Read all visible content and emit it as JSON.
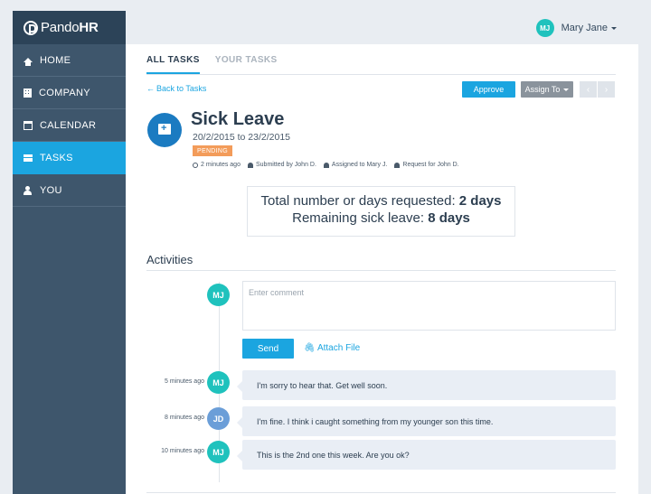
{
  "app": {
    "logo": {
      "prefix": "Pando",
      "suffix": "HR"
    },
    "user": {
      "initials": "MJ",
      "name": "Mary Jane"
    }
  },
  "sidebar": {
    "items": [
      {
        "label": "HOME",
        "icon": "home-icon",
        "active": false
      },
      {
        "label": "COMPANY",
        "icon": "building-icon",
        "active": false
      },
      {
        "label": "CALENDAR",
        "icon": "calendar-icon",
        "active": false
      },
      {
        "label": "TASKS",
        "icon": "tasks-icon",
        "active": true
      },
      {
        "label": "YOU",
        "icon": "user-icon",
        "active": false
      }
    ]
  },
  "tabs": [
    {
      "label": "ALL TASKS",
      "active": true
    },
    {
      "label": "YOUR TASKS",
      "active": false
    }
  ],
  "toolbar": {
    "back_label": "Back to Tasks",
    "approve_label": "Approve",
    "assign_label": "Assign To"
  },
  "task": {
    "title": "Sick Leave",
    "dates": "20/2/2015 to 23/2/2015",
    "status": "PENDING",
    "meta": {
      "time": "2 minutes ago",
      "submitted_by": "Submitted by John D.",
      "assigned_to": "Assigned to Mary J.",
      "request_for": "Request for John D."
    }
  },
  "summary": {
    "total_label": "Total number or days requested:",
    "total_value": "2 days",
    "remaining_label": "Remaining sick leave:",
    "remaining_value": "8 days"
  },
  "activities": {
    "title": "Activities",
    "comment": {
      "avatar_initials": "MJ",
      "placeholder": "Enter comment",
      "send_label": "Send",
      "attach_label": "Attach File"
    },
    "feed": [
      {
        "time": "5 minutes ago",
        "initials": "MJ",
        "text": "I'm sorry to hear that. Get well soon."
      },
      {
        "time": "8 minutes ago",
        "initials": "JD",
        "text": "I'm fine.  I think i caught something from my younger son this time."
      },
      {
        "time": "10 minutes ago",
        "initials": "MJ",
        "text": "This is the 2nd one this week. Are you ok?"
      }
    ]
  },
  "colors": {
    "accent": "#1ba5e0",
    "sidebar": "#3e566c",
    "sidebar_dark": "#2c4358",
    "pending_badge": "#f39c5a",
    "avatar_teal": "#1fc2bd",
    "avatar_blue": "#6b9ed8"
  }
}
